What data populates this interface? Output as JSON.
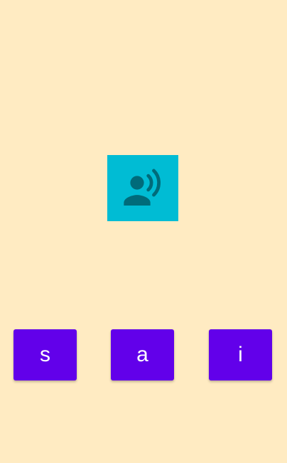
{
  "colors": {
    "background": "#FFEBC2",
    "speak_tile": "#00BCD4",
    "speak_icon": "#006B7A",
    "letter_button": "#6200EA",
    "letter_text": "#FFFFFF"
  },
  "speak_tile": {
    "icon": "record-voice-icon"
  },
  "letter_buttons": [
    {
      "label": "s"
    },
    {
      "label": "a"
    },
    {
      "label": "i"
    }
  ]
}
